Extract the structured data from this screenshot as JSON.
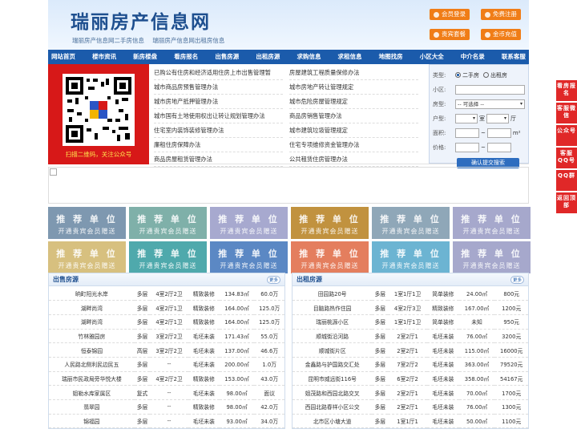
{
  "header": {
    "logo": "瑞丽房产信息网",
    "slogans": [
      "瑞丽房产信息网二手房信息",
      "瑞丽房产信息网出租房信息"
    ],
    "buttons": [
      "会员登录",
      "免费注册",
      "贵宾套餐",
      "金币充值"
    ],
    "accent_color": "#f07d17"
  },
  "nav": [
    "网站首页",
    "楼市资讯",
    "新房楼盘",
    "看房报名",
    "出售房源",
    "出租房源",
    "求购信息",
    "求租信息",
    "地图找房",
    "小区大全",
    "中介名录",
    "联系客服"
  ],
  "qr": {
    "caption": "扫描二维码，关注公众号"
  },
  "links": [
    "已购公有住房和经济适用住房上市出售管理暂",
    "房屋建筑工程质量保修办法",
    "城市商品房预售管理办法",
    "城市房地产转让管理规定",
    "城市房地产抵押管理办法",
    "城市危险房屋管理规定",
    "城市国有土地使用权出让转让规划管理办法",
    "商品房销售管理办法",
    "住宅室内装饰装修管理办法",
    "城市建筑垃圾管理规定",
    "廉租住房保障办法",
    "住宅专项维修资金管理办法",
    "商品房屋租赁管理办法",
    "公共租赁住房管理办法"
  ],
  "search": {
    "type_label": "类型:",
    "type_options": [
      "二手房",
      "出租房"
    ],
    "community_label": "小区:",
    "house_type_label": "房型:",
    "house_type_value": "-- 可选择 --",
    "layout_label": "户型:",
    "room_unit": "室",
    "hall_unit": "厅",
    "area_label": "面积:",
    "area_unit": "m²",
    "price_label": "价格:",
    "range_sep": "~",
    "submit": "确认提交搜索"
  },
  "ads": {
    "title": "推 荐 单 位",
    "subtitle": "开通贵宾会员赠送",
    "colors": [
      "#7e98b0",
      "#7fb0a9",
      "#a7a9cf",
      "#c1923f",
      "#8fa7b8",
      "#a6a8cc",
      "#d7c07f",
      "#4fa9ac",
      "#5b88c4",
      "#e47e5e",
      "#6cb4d2",
      "#a6a8cc"
    ]
  },
  "sale": {
    "title": "出售房源",
    "more": "更多",
    "rows": [
      [
        "晌町阳光水岸",
        "多层",
        "4室2厅2卫",
        "精致装修",
        "134.83㎡",
        "60.0万"
      ],
      [
        "湖畔尚湾",
        "多层",
        "4室2厅1卫",
        "精致装修",
        "164.00㎡",
        "125.0万"
      ],
      [
        "湖畔尚湾",
        "多层",
        "4室2厅1卫",
        "精致装修",
        "164.00㎡",
        "125.0万"
      ],
      [
        "竹林雅园房",
        "多层",
        "3室2厅2卫",
        "毛坯未装",
        "171.43㎡",
        "55.0万"
      ],
      [
        "恒泰锦园",
        "高层",
        "3室2厅2卫",
        "毛坯未装",
        "137.00㎡",
        "46.6万"
      ],
      [
        "人民路北侧利民边民五",
        "多层",
        "--",
        "毛坯未装",
        "200.00㎡",
        "1.0万"
      ],
      [
        "瑞丽市民政局旁华悦大楼",
        "多层",
        "4室2厅2卫",
        "精致装修",
        "153.00㎡",
        "43.0万"
      ],
      [
        "姐勒水库家属区",
        "复式",
        "--",
        "毛坯未装",
        "98.00㎡",
        "面议"
      ],
      [
        "翡翠园",
        "多层",
        "--",
        "精致装修",
        "98.00㎡",
        "42.0万"
      ],
      [
        "锦福园",
        "多层",
        "--",
        "毛坯未装",
        "93.00㎡",
        "34.0万"
      ]
    ]
  },
  "rent": {
    "title": "出租房源",
    "more": "更多",
    "rows": [
      [
        "田园路20号",
        "多层",
        "1室1厅1卫",
        "简单装修",
        "24.00㎡",
        "800元"
      ],
      [
        "目脑路热作住园",
        "多层",
        "4室2厅3卫",
        "精致装修",
        "167.00㎡",
        "1200元"
      ],
      [
        "瑞丽桃源小区",
        "多层",
        "1室1厅1卫",
        "简单装修",
        "未知",
        "950元"
      ],
      [
        "顺城街沿河路",
        "多层",
        "2室2厅1",
        "毛坯未装",
        "76.00㎡",
        "3200元"
      ],
      [
        "顺城街片区",
        "多层",
        "2室2厅1",
        "毛坯未装",
        "115.00㎡",
        "16000元"
      ],
      [
        "金鑫路与护国路交汇处",
        "多层",
        "7室2厅2",
        "毛坯未装",
        "363.00㎡",
        "79520元"
      ],
      [
        "昆明市威远街116号",
        "多层",
        "6室2厅2",
        "毛坯未装",
        "358.00㎡",
        "54167元"
      ],
      [
        "姐茂路和西园北路交叉",
        "多层",
        "2室2厅1",
        "毛坯未装",
        "70.00㎡",
        "1700元"
      ],
      [
        "西园北路春祥小区公交",
        "多层",
        "2室2厅1",
        "毛坯未装",
        "76.00㎡",
        "1300元"
      ],
      [
        "北市区小塘大道",
        "多层",
        "1室1厅1",
        "毛坯未装",
        "50.00㎡",
        "1100元"
      ]
    ]
  },
  "side": [
    "看房报名",
    "客服微信",
    "公众号",
    "客服QQ号",
    "QQ群",
    "返回顶部"
  ]
}
